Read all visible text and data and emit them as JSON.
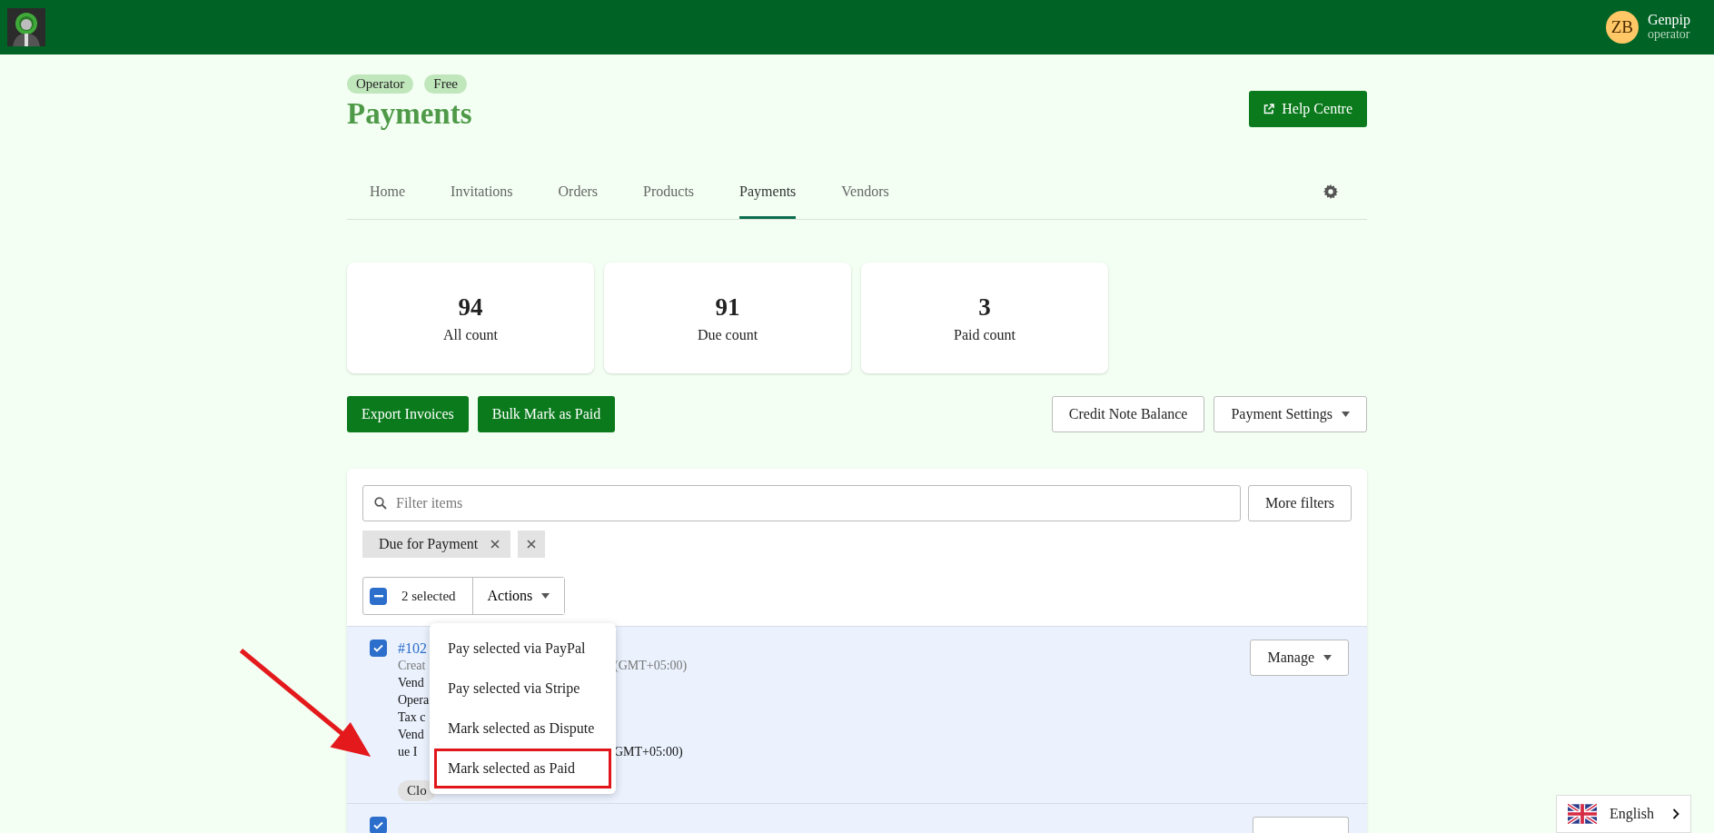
{
  "topbar": {
    "avatar_initials": "ZB",
    "user_name": "Genpip",
    "user_role": "operator"
  },
  "badges": [
    "Operator",
    "Free"
  ],
  "title": "Payments",
  "help_button": "Help Centre",
  "tabs": [
    {
      "label": "Home",
      "selected": false
    },
    {
      "label": "Invitations",
      "selected": false
    },
    {
      "label": "Orders",
      "selected": false
    },
    {
      "label": "Products",
      "selected": false
    },
    {
      "label": "Payments",
      "selected": true
    },
    {
      "label": "Vendors",
      "selected": false
    }
  ],
  "stats": [
    {
      "value": "94",
      "label": "All count"
    },
    {
      "value": "91",
      "label": "Due count"
    },
    {
      "value": "3",
      "label": "Paid count"
    }
  ],
  "primary_actions": [
    "Export Invoices",
    "Bulk Mark as Paid"
  ],
  "secondary_actions": [
    {
      "label": "Credit Note Balance",
      "dropdown": false
    },
    {
      "label": "Payment Settings",
      "dropdown": true
    }
  ],
  "filter": {
    "placeholder": "Filter items",
    "more_button": "More filters"
  },
  "chips": [
    {
      "kind": "tag",
      "label": "Due for Payment"
    },
    {
      "kind": "clear"
    }
  ],
  "selection": {
    "partial": true,
    "count_label": "2 selected",
    "actions_label": "Actions"
  },
  "actions_menu": [
    {
      "label": "Pay selected via PayPal",
      "highlighted": false
    },
    {
      "label": "Pay selected via Stripe",
      "highlighted": false
    },
    {
      "label": "Mark selected as Dispute",
      "highlighted": false
    },
    {
      "label": "Mark selected as Paid",
      "highlighted": true
    }
  ],
  "rows": [
    {
      "selected": true,
      "manage": "Manage",
      "tag": "Clo",
      "lines": [
        {
          "kind": "id",
          "left": "#102"
        },
        {
          "kind": "meta",
          "left": "Creat",
          "right": "(GMT+05:00)"
        },
        {
          "kind": "detail",
          "left": "Vend"
        },
        {
          "kind": "detail",
          "left": "Opera"
        },
        {
          "kind": "detail",
          "left": "Tax c"
        },
        {
          "kind": "detail",
          "left": "Vend"
        },
        {
          "kind": "detail",
          "left": "ue I",
          "right": "GMT+05:00)"
        }
      ]
    },
    {
      "selected": true
    }
  ],
  "language": {
    "label": "English"
  }
}
